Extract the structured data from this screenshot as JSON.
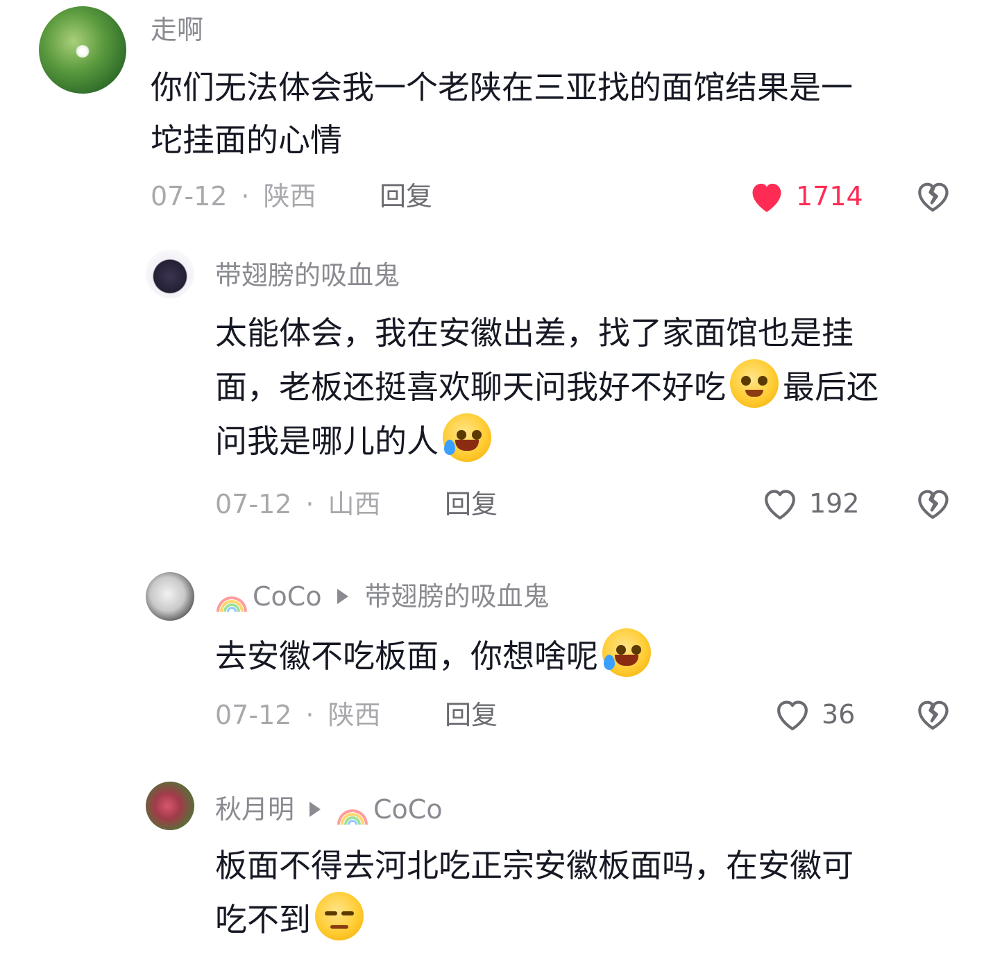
{
  "comments": [
    {
      "username": "走啊",
      "text_line1": "你们无法体会我一个老陕在三亚找的面馆结果是一",
      "text_line2": "坨挂面的心情",
      "date": "07-12",
      "location": "陕西",
      "reply_label": "回复",
      "likes": "1714",
      "liked": true
    },
    {
      "username": "带翅膀的吸血鬼",
      "text_line1": "太能体会，我在安徽出差，找了家面馆也是挂",
      "text_line2a": "面，老板还挺喜欢聊天问我好不好吃",
      "text_line2b": "最后还",
      "text_line3": "问我是哪儿的人",
      "date": "07-12",
      "location": "山西",
      "reply_label": "回复",
      "likes": "192",
      "liked": false
    },
    {
      "username": "CoCo",
      "reply_to": "带翅膀的吸血鬼",
      "text_line1": "去安徽不吃板面，你想啥呢",
      "date": "07-12",
      "location": "陕西",
      "reply_label": "回复",
      "likes": "36",
      "liked": false
    },
    {
      "username": "秋月明",
      "reply_to": "CoCo",
      "text_line1": "板面不得去河北吃正宗安徽板面吗，在安徽可",
      "text_line2": "吃不到"
    }
  ],
  "separator": "·",
  "colors": {
    "like_active": "#fe2c55",
    "meta_gray": "#a8a9ad",
    "name_gray": "#8a8b91"
  },
  "icons": [
    "heart-icon",
    "broken-heart-icon",
    "rainbow-icon",
    "emoji-icon",
    "reply-arrow-icon"
  ]
}
